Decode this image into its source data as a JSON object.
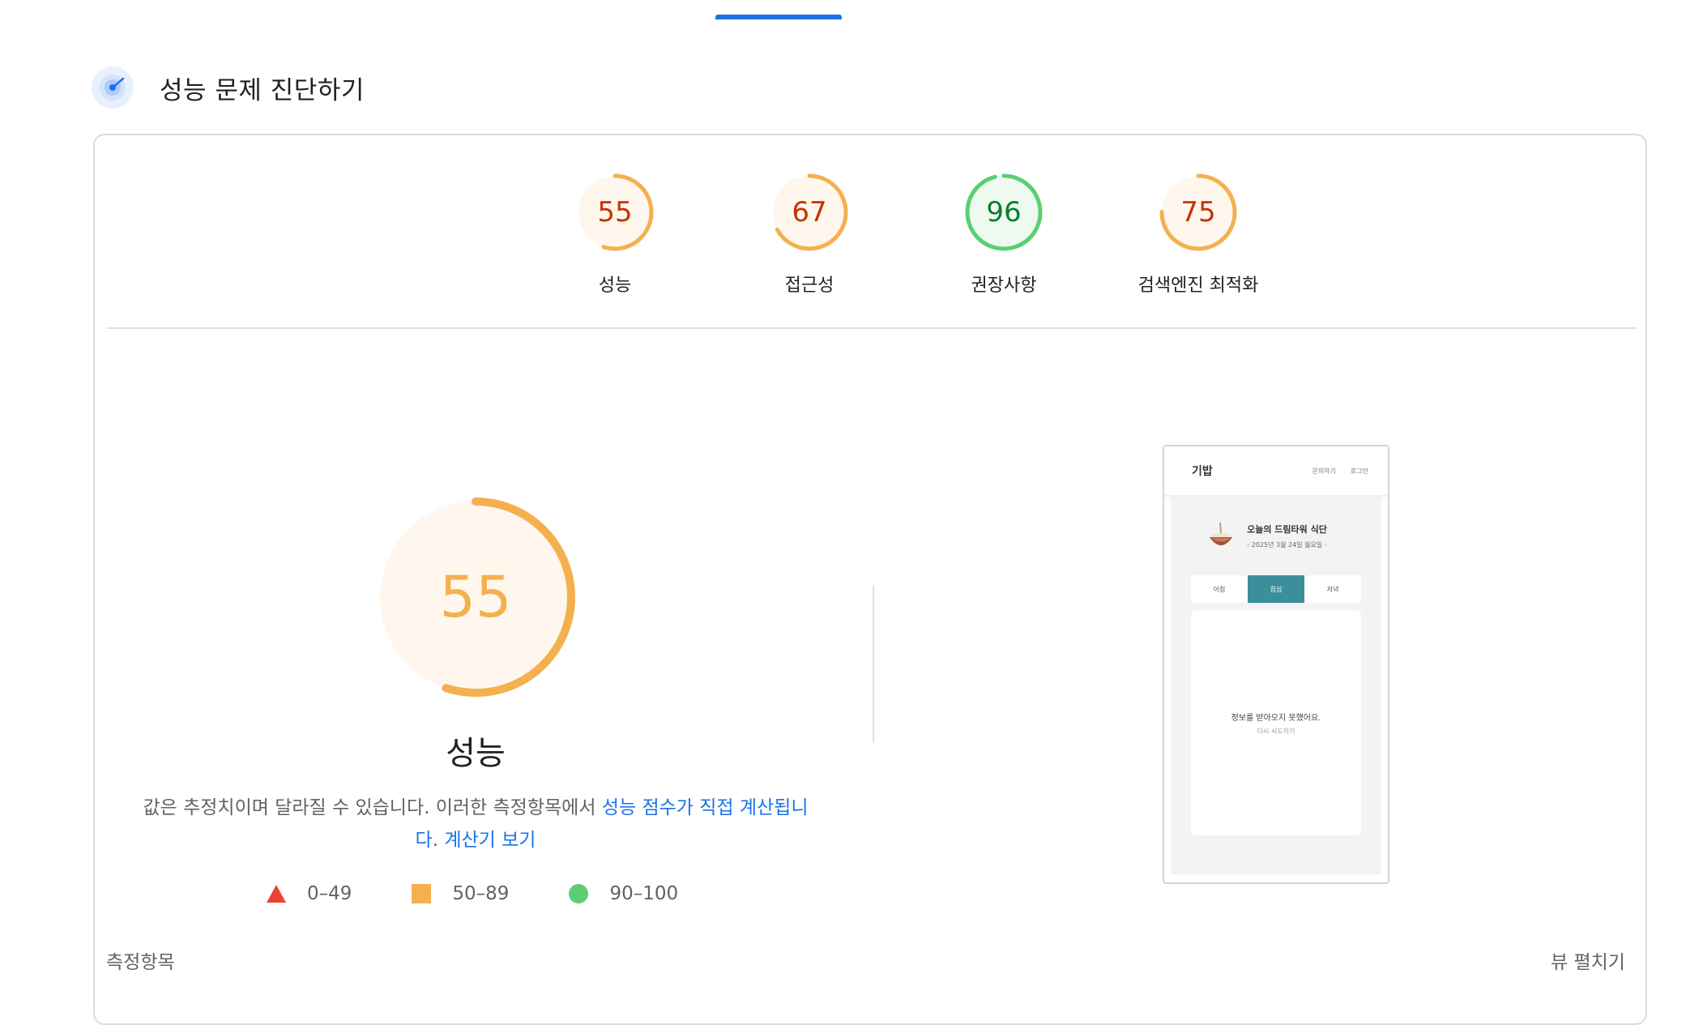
{
  "header": {
    "title": "성능 문제 진단하기",
    "icon": "lighthouse-icon"
  },
  "categories": [
    {
      "label": "성능",
      "score": 55,
      "status": "average"
    },
    {
      "label": "접근성",
      "score": 67,
      "status": "average"
    },
    {
      "label": "권장사항",
      "score": 96,
      "status": "pass"
    },
    {
      "label": "검색엔진 최적화",
      "score": 75,
      "status": "average"
    }
  ],
  "colors": {
    "average_arc": "#f4b04f",
    "average_text": "#c33300",
    "average_fill": "#fff7ed",
    "pass_arc": "#5cce71",
    "pass_text": "#0a7c2a",
    "pass_fill": "#eefaf0",
    "fail": "#eb4335",
    "link": "#1a73e8"
  },
  "main_score": {
    "score": 55,
    "title": "성능"
  },
  "description": {
    "text": "값은 추정치이며 달라질 수 있습니다. 이러한 측정항목에서 ",
    "link1": "성능 점수가 직접 계산됩니다",
    "sep": ". ",
    "link2": "계산기 보기"
  },
  "legend": [
    {
      "shape": "triangle",
      "range": "0–49"
    },
    {
      "shape": "square",
      "range": "50–89"
    },
    {
      "shape": "circle",
      "range": "90–100"
    }
  ],
  "preview": {
    "brand": "기밥",
    "nav_inquiry": "문의하기",
    "nav_login": "로그인",
    "title": "오늘의 드림타워 식단",
    "date": "2025년 3월 24일 월요일",
    "prev_arrow": "‹",
    "next_arrow": "›",
    "tabs": [
      "아침",
      "점심",
      "저녁"
    ],
    "active_tab": "점심",
    "error_message": "정보를 받아오지 못했어요.",
    "retry": "다시 시도하기"
  },
  "footer": {
    "metrics_label": "측정항목",
    "expand_view": "뷰 펼치기"
  }
}
